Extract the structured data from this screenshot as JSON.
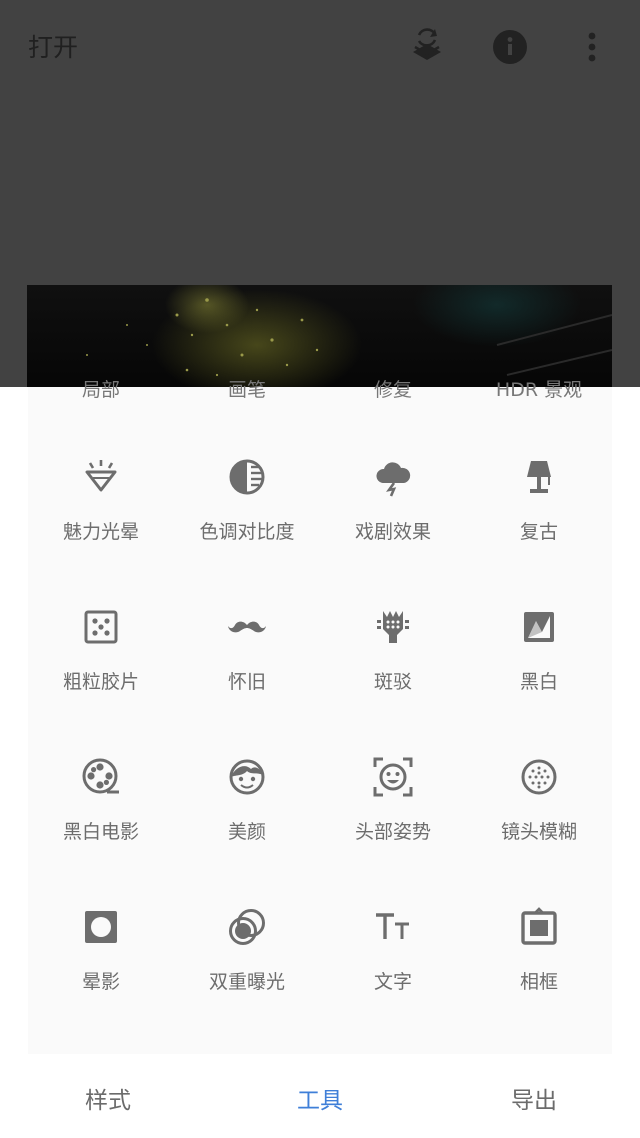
{
  "topbar": {
    "open_label": "打开",
    "icons": [
      "layers-revert-icon",
      "info-icon",
      "more-vert-icon"
    ]
  },
  "sheet": {
    "partial_row_labels": [
      "局部",
      "画笔",
      "修复",
      "HDR 景观"
    ],
    "tools": [
      {
        "label": "魅力光晕",
        "icon": "glamour-glow-icon"
      },
      {
        "label": "色调对比度",
        "icon": "tonal-contrast-icon"
      },
      {
        "label": "戏剧效果",
        "icon": "drama-cloud-icon"
      },
      {
        "label": "复古",
        "icon": "vintage-lamp-icon"
      },
      {
        "label": "粗粒胶片",
        "icon": "grainy-film-icon"
      },
      {
        "label": "怀旧",
        "icon": "mustache-icon"
      },
      {
        "label": "斑驳",
        "icon": "grunge-icon"
      },
      {
        "label": "黑白",
        "icon": "black-white-icon"
      },
      {
        "label": "黑白电影",
        "icon": "film-reel-icon"
      },
      {
        "label": "美颜",
        "icon": "face-icon"
      },
      {
        "label": "头部姿势",
        "icon": "head-pose-icon"
      },
      {
        "label": "镜头模糊",
        "icon": "lens-blur-icon"
      },
      {
        "label": "晕影",
        "icon": "vignette-icon"
      },
      {
        "label": "双重曝光",
        "icon": "double-exposure-icon"
      },
      {
        "label": "文字",
        "icon": "text-icon"
      },
      {
        "label": "相框",
        "icon": "frame-icon"
      }
    ]
  },
  "bottom_nav": {
    "tabs": [
      {
        "label": "样式",
        "active": false
      },
      {
        "label": "工具",
        "active": true
      },
      {
        "label": "导出",
        "active": false
      }
    ]
  },
  "colors": {
    "accent": "#3f7fd8",
    "icon": "#6d6d6d",
    "overlay": "#424242"
  }
}
